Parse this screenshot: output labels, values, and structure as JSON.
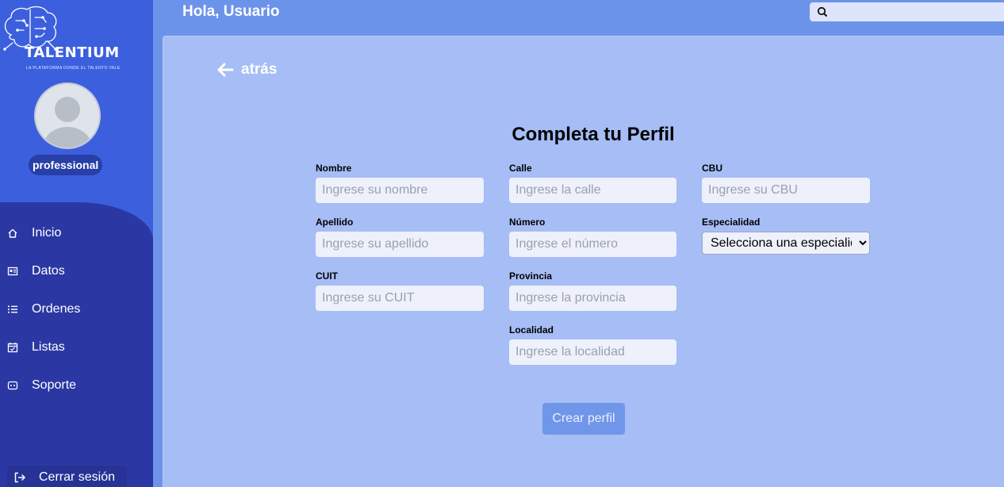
{
  "brand": {
    "name": "TALENTIUM",
    "tagline": "LA PLATAFORMA DONDE EL TALENTO VALE"
  },
  "user": {
    "role": "professional"
  },
  "nav": {
    "items": [
      {
        "label": "Inicio",
        "icon": "home-icon"
      },
      {
        "label": "Datos",
        "icon": "id-card-icon"
      },
      {
        "label": "Ordenes",
        "icon": "list-icon"
      },
      {
        "label": "Listas",
        "icon": "calendar-icon"
      },
      {
        "label": "Soporte",
        "icon": "support-icon"
      }
    ],
    "logout": {
      "label": "Cerrar sesión",
      "icon": "logout-icon"
    }
  },
  "header": {
    "greeting": "Hola, Usuario",
    "search_placeholder": ""
  },
  "back": {
    "label": "atrás"
  },
  "form": {
    "title": "Completa tu Perfil",
    "fields": {
      "nombre": {
        "label": "Nombre",
        "placeholder": "Ingrese su nombre"
      },
      "apellido": {
        "label": "Apellido",
        "placeholder": "Ingrese su apellido"
      },
      "cuit": {
        "label": "CUIT",
        "placeholder": "Ingrese su CUIT"
      },
      "calle": {
        "label": "Calle",
        "placeholder": "Ingrese la calle"
      },
      "numero": {
        "label": "Número",
        "placeholder": "Ingrese el número"
      },
      "provincia": {
        "label": "Provincia",
        "placeholder": "Ingrese la provincia"
      },
      "localidad": {
        "label": "Localidad",
        "placeholder": "Ingrese la localidad"
      },
      "cbu": {
        "label": "CBU",
        "placeholder": "Ingrese su CBU"
      },
      "especialidad": {
        "label": "Especialidad",
        "selected": "Selecciona una especialidad"
      }
    },
    "submit_label": "Crear perfil"
  },
  "colors": {
    "sidebar_top": "#3c5fde",
    "sidebar_nav": "#2b38a3",
    "header_bg": "#6c93ea",
    "panel_bg": "#a6bdf5",
    "button_bg": "#7096ea"
  }
}
